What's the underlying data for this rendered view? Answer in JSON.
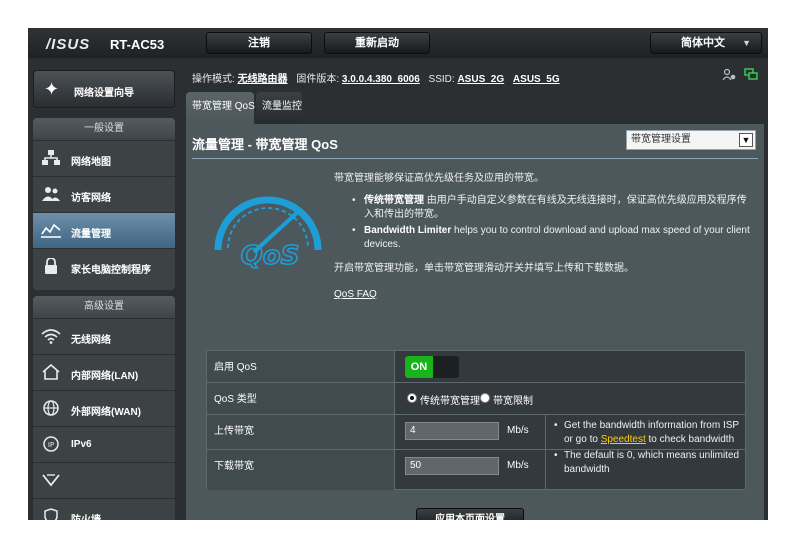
{
  "header": {
    "brand": "/ISUS",
    "model": "RT-AC53",
    "logout_label": "注销",
    "reboot_label": "重新启动",
    "language_label": "简体中文"
  },
  "sidebar": {
    "wizard_label": "网络设置向导",
    "general_title": "一般设置",
    "general_items": [
      {
        "label": "网络地图",
        "icon": "network-map-icon"
      },
      {
        "label": "访客网络",
        "icon": "guest-users-icon"
      },
      {
        "label": "流量管理",
        "icon": "traffic-icon",
        "active": true
      },
      {
        "label": "家长电脑控制程序",
        "icon": "parental-lock-icon"
      }
    ],
    "advanced_title": "高级设置",
    "advanced_items": [
      {
        "label": "无线网络",
        "icon": "wifi-icon"
      },
      {
        "label": "内部网络(LAN)",
        "icon": "home-icon"
      },
      {
        "label": "外部网络(WAN)",
        "icon": "globe-icon"
      },
      {
        "label": "IPv6",
        "icon": "ipv6-icon"
      },
      {
        "label": "",
        "icon": "vpn-icon"
      },
      {
        "label": "防火墙",
        "icon": "firewall-icon"
      }
    ]
  },
  "statusbar": {
    "mode_label": "操作模式:",
    "mode_value": "无线路由器",
    "firmware_label": "固件版本:",
    "firmware_value": "3.0.0.4.380_6006",
    "ssid_label": "SSID:",
    "ssid_2g": "ASUS_2G",
    "ssid_5g": "ASUS_5G"
  },
  "tabs": [
    {
      "label": "带宽管理 QoS",
      "active": true
    },
    {
      "label": "流量监控",
      "active": false
    }
  ],
  "content": {
    "title": "流量管理 - 带宽管理 QoS",
    "select_value": "带宽管理设置",
    "intro": "带宽管理能够保证高优先级任务及应用的带宽。",
    "bullet1_bold": "传统带宽管理",
    "bullet1_text": " 由用户手动自定义参数在有线及无线连接时，保证高优先级应用及程序传入和传出的带宽。",
    "bullet2_bold": "Bandwidth Limiter",
    "bullet2_text": " helps you to control download and upload max speed of your client devices.",
    "instruction": "开启带宽管理功能，单击带宽管理滑动开关并填写上传和下载数据。",
    "faq_link": "QoS FAQ"
  },
  "settings": {
    "enable_label": "启用 QoS",
    "toggle_on": "ON",
    "type_label": "QoS 类型",
    "type_option1": "传统带宽管理",
    "type_option2": "带宽限制",
    "upload_label": "上传带宽",
    "upload_value": "4",
    "download_label": "下载带宽",
    "download_value": "50",
    "unit": "Mb/s",
    "hint1_pre": "Get the bandwidth information from ISP or go to ",
    "hint1_link": "Speedtest",
    "hint1_post": " to check bandwidth",
    "hint2": "The default is 0, which means unlimited bandwidth"
  },
  "apply_label": "应用本页面设置",
  "colors": {
    "toggle_on": "#19b31c",
    "active_menu": "#4f7592",
    "link_accent": "#ffcc00",
    "status_online": "#39d353"
  }
}
